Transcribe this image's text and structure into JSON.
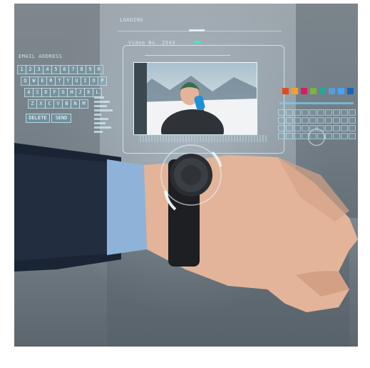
{
  "hud": {
    "loading_label": "LOADING",
    "video_label": "Video No. 2943",
    "keyboard_title": "EMAIL ADDRESS",
    "delete_label": "DELETE",
    "send_label": "SEND"
  },
  "keyboard_rows": [
    [
      "1",
      "2",
      "3",
      "4",
      "5",
      "6",
      "7",
      "8",
      "9",
      "0"
    ],
    [
      "Q",
      "W",
      "E",
      "R",
      "T",
      "Y",
      "U",
      "I",
      "O",
      "P"
    ],
    [
      "A",
      "S",
      "D",
      "F",
      "G",
      "H",
      "J",
      "K",
      "L"
    ],
    [
      "Z",
      "X",
      "C",
      "V",
      "B",
      "N",
      "M"
    ]
  ],
  "app_tile_colors": [
    "#e64a19",
    "#f4a12b",
    "#d81b60",
    "#7cb342",
    "#26a69a",
    "#5c9bd6",
    "#42a5f5",
    "#1565c0"
  ]
}
